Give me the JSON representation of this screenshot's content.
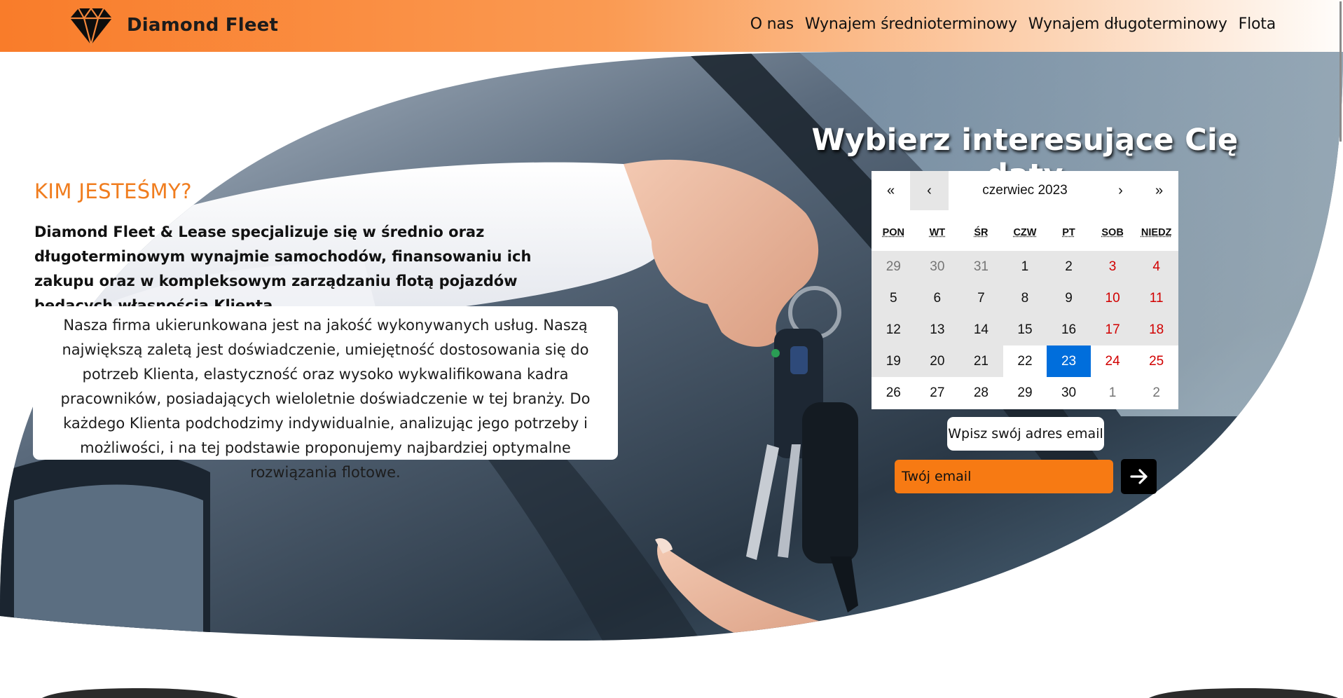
{
  "header": {
    "brand": "Diamond Fleet",
    "nav": [
      "O nas",
      "Wynajem średnioterminowy",
      "Wynajem długoterminowy",
      "Flota"
    ]
  },
  "about": {
    "title": "KIM JESTEŚMY?",
    "lead": "Diamond Fleet & Lease specjalizuje się w średnio oraz długoterminowym wynajmie samochodów, finansowaniu ich zakupu oraz w kompleksowym zarządzaniu flotą pojazdów będących własnością Klienta.",
    "body": "Nasza firma ukierunkowana jest na jakość wykonywanych usług. Naszą największą zaletą jest doświadczenie, umiejętność dostosowania się do potrzeb Klienta, elastyczność oraz wysoko wykwalifikowana kadra pracowników, posiadających wieloletnie doświadczenie w tej branży. Do każdego Klienta podchodzimy indywidualnie, analizując jego potrzeby i możliwości, i na tej podstawie proponujemy najbardziej optymalne rozwiązania flotowe."
  },
  "booking": {
    "title": "Wybierz interesujące Cię daty",
    "calendar": {
      "nav": {
        "prev2": "«",
        "prev": "‹",
        "label": "czerwiec 2023",
        "next": "›",
        "next2": "»"
      },
      "weekdays": [
        "PON",
        "WT",
        "ŚR",
        "CZW",
        "PT",
        "SOB",
        "NIEDZ"
      ],
      "weeks": [
        [
          "29",
          "30",
          "31",
          "1",
          "2",
          "3",
          "4"
        ],
        [
          "5",
          "6",
          "7",
          "8",
          "9",
          "10",
          "11"
        ],
        [
          "12",
          "13",
          "14",
          "15",
          "16",
          "17",
          "18"
        ],
        [
          "19",
          "20",
          "21",
          "22",
          "23",
          "24",
          "25"
        ],
        [
          "26",
          "27",
          "28",
          "29",
          "30",
          "1",
          "2"
        ]
      ],
      "selected": "23",
      "colors": {
        "selected": "#006edc",
        "weekend": "#d10000",
        "other_month": "#757575",
        "highlight": "#e6e6e6"
      }
    },
    "email_label": "Wpisz swój adres email",
    "email_placeholder": "Twój email",
    "submit_icon": "arrow-right-icon"
  },
  "colors": {
    "accent": "#f07d1f",
    "input": "#f77a13"
  }
}
